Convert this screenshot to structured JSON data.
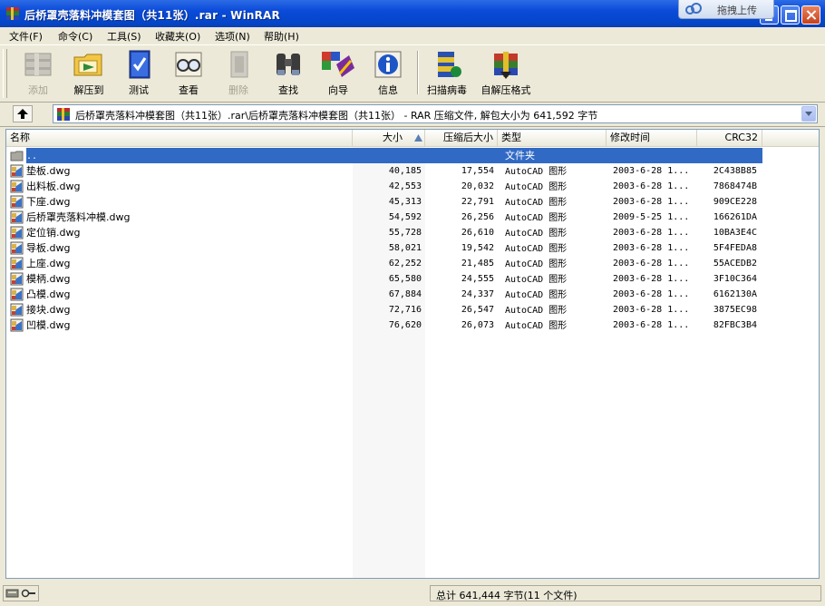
{
  "window": {
    "title": "后桥罩壳落料冲模套图（共11张）.rar - WinRAR",
    "controls": [
      "minimize",
      "maximize",
      "close"
    ]
  },
  "upload_widget": {
    "label": "拖拽上传",
    "icon": "cloud-upload-icon"
  },
  "menu": [
    {
      "label": "文件(F)"
    },
    {
      "label": "命令(C)"
    },
    {
      "label": "工具(S)"
    },
    {
      "label": "收藏夹(O)"
    },
    {
      "label": "选项(N)"
    },
    {
      "label": "帮助(H)"
    }
  ],
  "toolbar": [
    {
      "label": "添加",
      "icon": "add-books-icon",
      "enabled": false
    },
    {
      "label": "解压到",
      "icon": "extract-folder-icon",
      "enabled": true
    },
    {
      "label": "测试",
      "icon": "test-book-icon",
      "enabled": true
    },
    {
      "label": "查看",
      "icon": "view-glasses-icon",
      "enabled": true
    },
    {
      "label": "删除",
      "icon": "delete-icon",
      "enabled": false
    },
    {
      "label": "查找",
      "icon": "binoculars-icon",
      "enabled": true
    },
    {
      "label": "向导",
      "icon": "wizard-icon",
      "enabled": true
    },
    {
      "label": "信息",
      "icon": "info-icon",
      "enabled": true
    },
    {
      "label": "扫描病毒",
      "icon": "virus-scan-icon",
      "enabled": true
    },
    {
      "label": "自解压格式",
      "icon": "sfx-icon",
      "enabled": true
    }
  ],
  "address": {
    "text": "后桥罩壳落料冲模套图（共11张）.rar\\后桥罩壳落料冲模套图（共11张） - RAR 压缩文件, 解包大小为 641,592 字节"
  },
  "columns": {
    "name": "名称",
    "size": "大小",
    "packed": "压缩后大小",
    "type": "类型",
    "modified": "修改时间",
    "crc": "CRC32"
  },
  "parent_row": {
    "name": "..",
    "type": "文件夹"
  },
  "files": [
    {
      "name": "垫板.dwg",
      "size": "40,185",
      "packed": "17,554",
      "type": "AutoCAD 图形",
      "modified": "2003-6-28 1...",
      "crc": "2C438B85"
    },
    {
      "name": "出料板.dwg",
      "size": "42,553",
      "packed": "20,032",
      "type": "AutoCAD 图形",
      "modified": "2003-6-28 1...",
      "crc": "7868474B"
    },
    {
      "name": "下座.dwg",
      "size": "45,313",
      "packed": "22,791",
      "type": "AutoCAD 图形",
      "modified": "2003-6-28 1...",
      "crc": "909CE228"
    },
    {
      "name": "后桥罩壳落料冲模.dwg",
      "size": "54,592",
      "packed": "26,256",
      "type": "AutoCAD 图形",
      "modified": "2009-5-25 1...",
      "crc": "166261DA"
    },
    {
      "name": "定位销.dwg",
      "size": "55,728",
      "packed": "26,610",
      "type": "AutoCAD 图形",
      "modified": "2003-6-28 1...",
      "crc": "10BA3E4C"
    },
    {
      "name": "导板.dwg",
      "size": "58,021",
      "packed": "19,542",
      "type": "AutoCAD 图形",
      "modified": "2003-6-28 1...",
      "crc": "5F4FEDA8"
    },
    {
      "name": "上座.dwg",
      "size": "62,252",
      "packed": "21,485",
      "type": "AutoCAD 图形",
      "modified": "2003-6-28 1...",
      "crc": "55ACEDB2"
    },
    {
      "name": "模柄.dwg",
      "size": "65,580",
      "packed": "24,555",
      "type": "AutoCAD 图形",
      "modified": "2003-6-28 1...",
      "crc": "3F10C364"
    },
    {
      "name": "凸模.dwg",
      "size": "67,884",
      "packed": "24,337",
      "type": "AutoCAD 图形",
      "modified": "2003-6-28 1...",
      "crc": "6162130A"
    },
    {
      "name": "接块.dwg",
      "size": "72,716",
      "packed": "26,547",
      "type": "AutoCAD 图形",
      "modified": "2003-6-28 1...",
      "crc": "3875EC98"
    },
    {
      "name": "凹模.dwg",
      "size": "76,620",
      "packed": "26,073",
      "type": "AutoCAD 图形",
      "modified": "2003-6-28 1...",
      "crc": "82FBC3B4"
    }
  ],
  "status": {
    "total": "总计 641,444 字节(11 个文件)"
  },
  "colors": {
    "title_bar": "#0a4ad8",
    "selection": "#316ac5",
    "window_bg": "#ece9d8"
  }
}
